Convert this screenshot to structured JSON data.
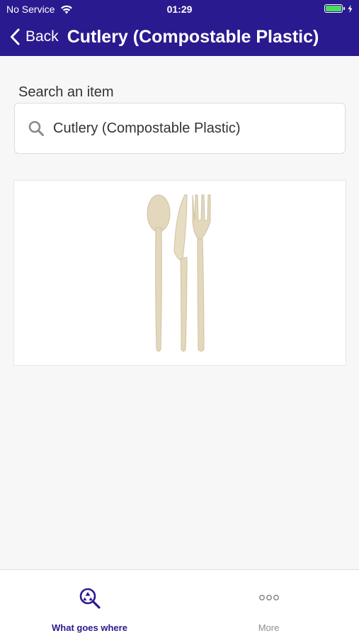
{
  "status_bar": {
    "carrier": "No Service",
    "time": "01:29",
    "battery_color": "#4cd964"
  },
  "nav": {
    "back_label": "Back",
    "title": "Cutlery (Compostable Plastic)",
    "background_color": "#2a1a8f"
  },
  "search": {
    "label": "Search an item",
    "value": "Cutlery (Compostable Plastic)",
    "icon": "search-icon"
  },
  "item_image": {
    "subject": "spoon, knife and fork",
    "color": "#e6dcc0"
  },
  "tab_bar": {
    "tabs": [
      {
        "label": "What goes where",
        "icon": "recycle-search-icon",
        "active": true
      },
      {
        "label": "More",
        "icon": "more-dots-icon",
        "active": false
      }
    ],
    "active_color": "#2a1a8f",
    "inactive_color": "#8e8e93"
  }
}
